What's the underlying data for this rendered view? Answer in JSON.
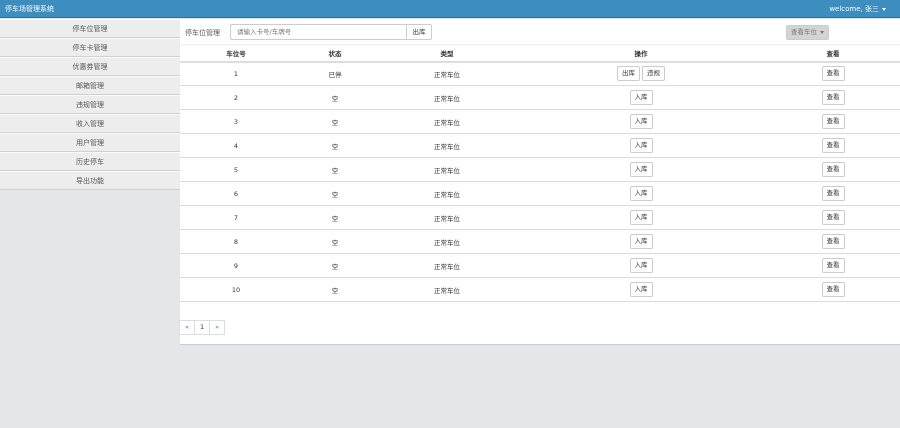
{
  "header": {
    "title": "停车场管理系统",
    "user": "welcome, 张三"
  },
  "sidebar": {
    "items": [
      "停车位管理",
      "停车卡管理",
      "优惠券管理",
      "邮箱管理",
      "违规管理",
      "收入管理",
      "用户管理",
      "历史停车",
      "导出功能"
    ]
  },
  "toolbar": {
    "label": "停车位管理",
    "search_placeholder": "请输入卡号/车牌号",
    "out_button": "出库",
    "view_dropdown": "查看车位"
  },
  "table": {
    "headers": [
      "车位号",
      "状态",
      "类型",
      "操作",
      "查看"
    ],
    "rows": [
      {
        "no": "1",
        "status": "已停",
        "type": "正常车位",
        "actions": [
          "出库",
          "违规"
        ],
        "view": "查看"
      },
      {
        "no": "2",
        "status": "空",
        "type": "正常车位",
        "actions": [
          "入库"
        ],
        "view": "查看"
      },
      {
        "no": "3",
        "status": "空",
        "type": "正常车位",
        "actions": [
          "入库"
        ],
        "view": "查看"
      },
      {
        "no": "4",
        "status": "空",
        "type": "正常车位",
        "actions": [
          "入库"
        ],
        "view": "查看"
      },
      {
        "no": "5",
        "status": "空",
        "type": "正常车位",
        "actions": [
          "入库"
        ],
        "view": "查看"
      },
      {
        "no": "6",
        "status": "空",
        "type": "正常车位",
        "actions": [
          "入库"
        ],
        "view": "查看"
      },
      {
        "no": "7",
        "status": "空",
        "type": "正常车位",
        "actions": [
          "入库"
        ],
        "view": "查看"
      },
      {
        "no": "8",
        "status": "空",
        "type": "正常车位",
        "actions": [
          "入库"
        ],
        "view": "查看"
      },
      {
        "no": "9",
        "status": "空",
        "type": "正常车位",
        "actions": [
          "入库"
        ],
        "view": "查看"
      },
      {
        "no": "10",
        "status": "空",
        "type": "正常车位",
        "actions": [
          "入库"
        ],
        "view": "查看"
      }
    ]
  },
  "pagination": {
    "prev": "«",
    "page": "1",
    "next": "»"
  }
}
